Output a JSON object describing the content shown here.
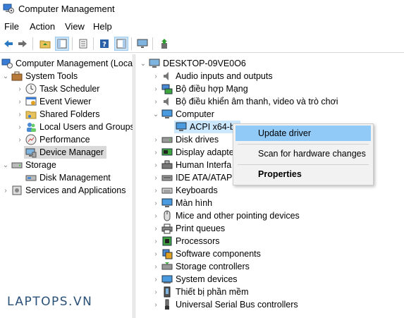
{
  "window": {
    "title": "Computer Management"
  },
  "menu": [
    "File",
    "Action",
    "View",
    "Help"
  ],
  "toolbar_icons": [
    "back-arrow-icon",
    "forward-arrow-icon",
    "up-folder-icon",
    "show-hide-tree-icon",
    "properties-icon",
    "help-icon",
    "action-pane-icon",
    "monitor-icon",
    "update-driver-icon"
  ],
  "left_tree": {
    "root": "Computer Management (Local",
    "items": [
      {
        "label": "System Tools"
      },
      {
        "label": "Task Scheduler"
      },
      {
        "label": "Event Viewer"
      },
      {
        "label": "Shared Folders"
      },
      {
        "label": "Local Users and Groups"
      },
      {
        "label": "Performance"
      },
      {
        "label": "Device Manager"
      },
      {
        "label": "Storage"
      },
      {
        "label": "Disk Management"
      },
      {
        "label": "Services and Applications"
      }
    ]
  },
  "device_tree": {
    "root": "DESKTOP-09VE0O6",
    "categories": [
      "Audio inputs and outputs",
      "Bộ điều hợp Mạng",
      "Bộ điều khiển âm thanh, video và trò chơi",
      "Computer",
      "ACPI x64-b",
      "Disk drives",
      "Display adapte",
      "Human Interfa",
      "IDE ATA/ATAPI",
      "Keyboards",
      "Màn hình",
      "Mice and other pointing devices",
      "Print queues",
      "Processors",
      "Software components",
      "Storage controllers",
      "System devices",
      "Thiết bị phần mềm",
      "Universal Serial Bus controllers"
    ]
  },
  "context_menu": {
    "update_driver": "Update driver",
    "scan": "Scan for hardware changes",
    "properties": "Properties"
  },
  "watermark": "LAPTOPS.VN",
  "colors": {
    "selection": "#d9d9d9",
    "highlight": "#91c9f7",
    "watermark": "#2a5078"
  }
}
